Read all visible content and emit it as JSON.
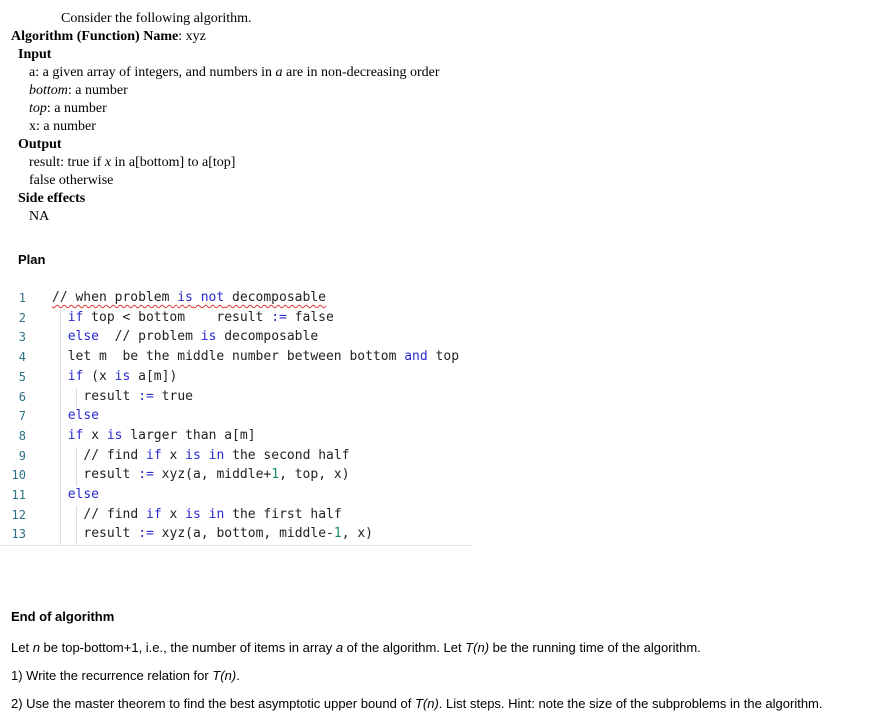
{
  "header": {
    "intro": "Consider the following algorithm.",
    "name_label": "Algorithm (Function) Name",
    "name_value": ": xyz"
  },
  "input": {
    "heading": "Input",
    "lines": [
      [
        {
          "t": "a: a given array of integers, and numbers in "
        },
        {
          "t": "a",
          "s": "i"
        },
        {
          "t": " are in non-decreasing order"
        }
      ],
      [
        {
          "t": "bottom",
          "s": "i"
        },
        {
          "t": ": a number"
        }
      ],
      [
        {
          "t": "top",
          "s": "i"
        },
        {
          "t": ": a number"
        }
      ],
      [
        {
          "t": "x: a number"
        }
      ]
    ]
  },
  "output": {
    "heading": "Output",
    "lines": [
      [
        {
          "t": "result: true if "
        },
        {
          "t": "x",
          "s": "i"
        },
        {
          "t": " in a[bottom] to a[top]"
        }
      ],
      [
        {
          "t": "false otherwise"
        }
      ]
    ]
  },
  "side_effects": {
    "heading": "Side effects",
    "value": "NA"
  },
  "plan": {
    "heading": "Plan",
    "colors": {
      "keyword": "#2a2ad0",
      "number": "#1a8a5a",
      "line_number": "#2f7287",
      "text": "#222222",
      "spellcheck": "#dd3333"
    },
    "lines": [
      {
        "n": "1",
        "indent": 0,
        "seg": [
          {
            "t": "// when problem "
          },
          {
            "t": "is",
            "s": "kw"
          },
          {
            "t": " "
          },
          {
            "t": "not",
            "s": "kw"
          },
          {
            "t": " decomposable"
          }
        ]
      },
      {
        "n": "2",
        "indent": 1,
        "seg": [
          {
            "t": "if",
            "s": "kw"
          },
          {
            "t": " top < bottom    result "
          },
          {
            "t": ":=",
            "s": "kw"
          },
          {
            "t": " false"
          }
        ]
      },
      {
        "n": "3",
        "indent": 1,
        "seg": [
          {
            "t": "else",
            "s": "kw"
          },
          {
            "t": "  // problem "
          },
          {
            "t": "is",
            "s": "kw"
          },
          {
            "t": " decomposable"
          }
        ]
      },
      {
        "n": "4",
        "indent": 1,
        "seg": [
          {
            "t": "let m  be the middle number between bottom "
          },
          {
            "t": "and",
            "s": "kw"
          },
          {
            "t": " top"
          }
        ]
      },
      {
        "n": "5",
        "indent": 1,
        "seg": [
          {
            "t": "if",
            "s": "kw"
          },
          {
            "t": " (x "
          },
          {
            "t": "is",
            "s": "kw"
          },
          {
            "t": " a[m])"
          }
        ]
      },
      {
        "n": "6",
        "indent": 2,
        "seg": [
          {
            "t": "result "
          },
          {
            "t": ":=",
            "s": "kw"
          },
          {
            "t": " true"
          }
        ]
      },
      {
        "n": "7",
        "indent": 1,
        "seg": [
          {
            "t": "else",
            "s": "kw"
          }
        ]
      },
      {
        "n": "8",
        "indent": 1,
        "seg": [
          {
            "t": "if",
            "s": "kw"
          },
          {
            "t": " x "
          },
          {
            "t": "is",
            "s": "kw"
          },
          {
            "t": " larger than a[m]"
          }
        ]
      },
      {
        "n": "9",
        "indent": 2,
        "seg": [
          {
            "t": "// find "
          },
          {
            "t": "if",
            "s": "kw"
          },
          {
            "t": " x "
          },
          {
            "t": "is",
            "s": "kw"
          },
          {
            "t": " "
          },
          {
            "t": "in",
            "s": "kw"
          },
          {
            "t": " the second half"
          }
        ]
      },
      {
        "n": "10",
        "indent": 2,
        "seg": [
          {
            "t": "result "
          },
          {
            "t": ":=",
            "s": "kw"
          },
          {
            "t": " xyz(a, middle+"
          },
          {
            "t": "1",
            "s": "num"
          },
          {
            "t": ", top, x)"
          }
        ]
      },
      {
        "n": "11",
        "indent": 1,
        "seg": [
          {
            "t": "else",
            "s": "kw"
          }
        ]
      },
      {
        "n": "12",
        "indent": 2,
        "seg": [
          {
            "t": "// find "
          },
          {
            "t": "if",
            "s": "kw"
          },
          {
            "t": " x "
          },
          {
            "t": "is",
            "s": "kw"
          },
          {
            "t": " "
          },
          {
            "t": "in",
            "s": "kw"
          },
          {
            "t": " the first half"
          }
        ]
      },
      {
        "n": "13",
        "indent": 2,
        "seg": [
          {
            "t": "result "
          },
          {
            "t": ":=",
            "s": "kw"
          },
          {
            "t": " xyz(a, bottom, middle-"
          },
          {
            "t": "1",
            "s": "num"
          },
          {
            "t": ", x)"
          }
        ]
      }
    ]
  },
  "footer": {
    "end_label": "End of algorithm",
    "lines": [
      [
        {
          "t": "Let "
        },
        {
          "t": "n",
          "s": "i"
        },
        {
          "t": " be top-bottom+1, i.e., the number of items in array "
        },
        {
          "t": "a",
          "s": "i"
        },
        {
          "t": " of the algorithm. Let "
        },
        {
          "t": "T(n)",
          "s": "i"
        },
        {
          "t": " be the running time of the algorithm."
        }
      ],
      [
        {
          "t": "1) Write the recurrence relation for "
        },
        {
          "t": "T(n)",
          "s": "i"
        },
        {
          "t": "."
        }
      ],
      [
        {
          "t": "2) Use the master theorem to find the best asymptotic upper bound of "
        },
        {
          "t": "T(n)",
          "s": "i"
        },
        {
          "t": ". List steps. Hint: note the size of the subproblems in the algorithm."
        }
      ]
    ]
  }
}
